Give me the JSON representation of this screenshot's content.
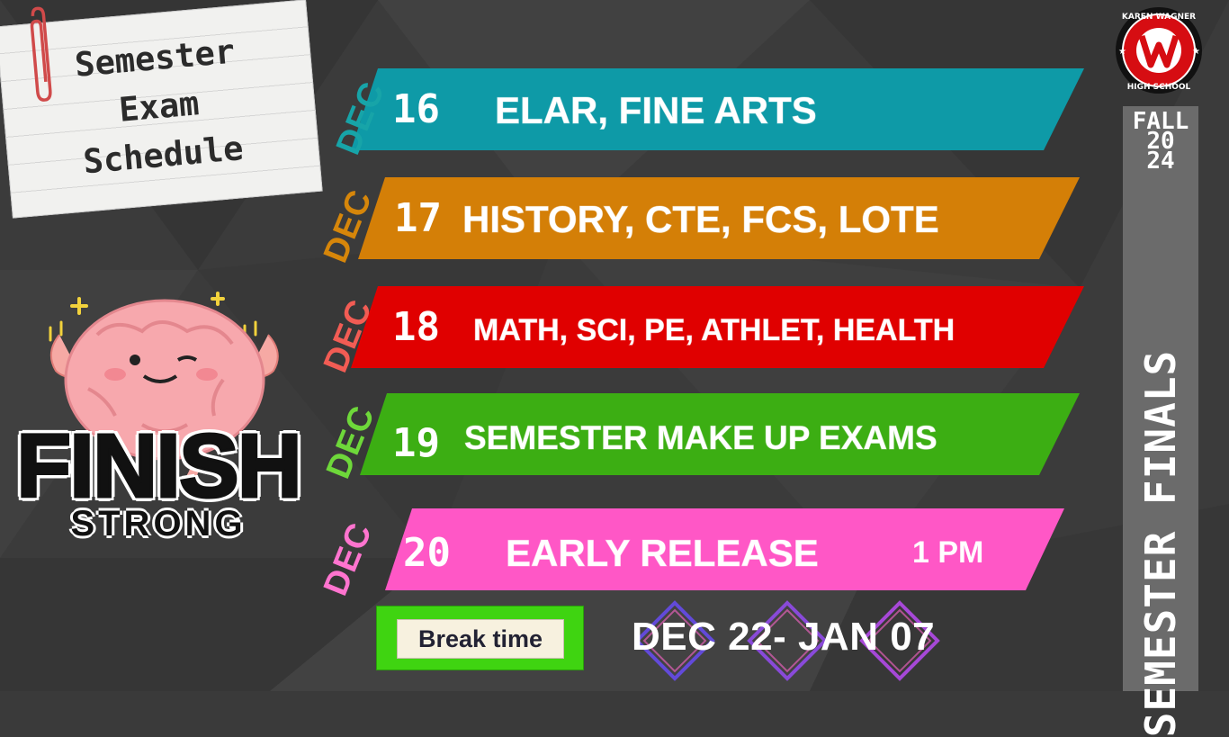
{
  "note": {
    "line1": "Semester",
    "line2": "Exam",
    "line3": "Schedule"
  },
  "rows": [
    {
      "dec": "DEC",
      "day": "16",
      "subjects": "ELAR,  FINE ARTS",
      "extra": "",
      "color": "#0e9aa7",
      "dec_color": "#17a4a8"
    },
    {
      "dec": "DEC",
      "day": "17",
      "subjects": "HISTORY, CTE,  FCS, LOTE",
      "extra": "",
      "color": "#d47f07",
      "dec_color": "#d6860a"
    },
    {
      "dec": "DEC",
      "day": "18",
      "subjects": "MATH, SCI, PE, ATHLET, HEALTH",
      "extra": "",
      "color": "#e00000",
      "dec_color": "#f25c54"
    },
    {
      "dec": "DEC",
      "day": "19",
      "subjects": "SEMESTER MAKE UP EXAMS",
      "extra": "",
      "color": "#3cae13",
      "dec_color": "#6ed83a"
    },
    {
      "dec": "DEC",
      "day": "20",
      "subjects": "EARLY RELEASE",
      "extra": "1 PM",
      "color": "#ff57c6",
      "dec_color": "#ff74cf"
    }
  ],
  "sidebar": {
    "fall": "FALL",
    "year_top": "20",
    "year_bottom": "24",
    "vertical": "SEMESTER FINALS"
  },
  "seal": {
    "top": "KAREN WAGNER",
    "bottom": "HIGH SCHOOL"
  },
  "break": {
    "label": "Break time",
    "dates": "DEC 22- JAN 07"
  },
  "finish": {
    "line1": "FINISH",
    "line2": "STRONG"
  }
}
